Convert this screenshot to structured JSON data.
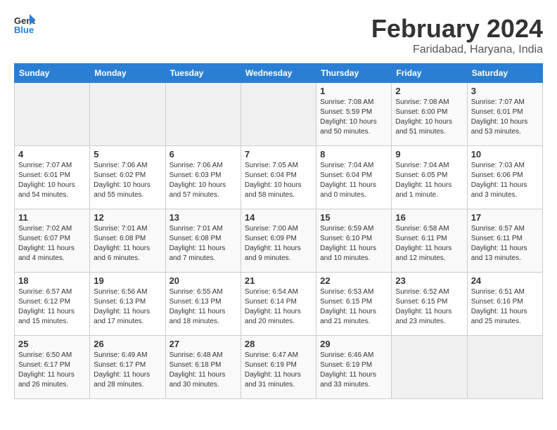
{
  "header": {
    "logo_line1": "General",
    "logo_line2": "Blue",
    "title": "February 2024",
    "subtitle": "Faridabad, Haryana, India"
  },
  "weekdays": [
    "Sunday",
    "Monday",
    "Tuesday",
    "Wednesday",
    "Thursday",
    "Friday",
    "Saturday"
  ],
  "weeks": [
    {
      "days": [
        {
          "num": "",
          "info": ""
        },
        {
          "num": "",
          "info": ""
        },
        {
          "num": "",
          "info": ""
        },
        {
          "num": "",
          "info": ""
        },
        {
          "num": "1",
          "info": "Sunrise: 7:08 AM\nSunset: 5:59 PM\nDaylight: 10 hours\nand 50 minutes."
        },
        {
          "num": "2",
          "info": "Sunrise: 7:08 AM\nSunset: 6:00 PM\nDaylight: 10 hours\nand 51 minutes."
        },
        {
          "num": "3",
          "info": "Sunrise: 7:07 AM\nSunset: 6:01 PM\nDaylight: 10 hours\nand 53 minutes."
        }
      ]
    },
    {
      "days": [
        {
          "num": "4",
          "info": "Sunrise: 7:07 AM\nSunset: 6:01 PM\nDaylight: 10 hours\nand 54 minutes."
        },
        {
          "num": "5",
          "info": "Sunrise: 7:06 AM\nSunset: 6:02 PM\nDaylight: 10 hours\nand 55 minutes."
        },
        {
          "num": "6",
          "info": "Sunrise: 7:06 AM\nSunset: 6:03 PM\nDaylight: 10 hours\nand 57 minutes."
        },
        {
          "num": "7",
          "info": "Sunrise: 7:05 AM\nSunset: 6:04 PM\nDaylight: 10 hours\nand 58 minutes."
        },
        {
          "num": "8",
          "info": "Sunrise: 7:04 AM\nSunset: 6:04 PM\nDaylight: 11 hours\nand 0 minutes."
        },
        {
          "num": "9",
          "info": "Sunrise: 7:04 AM\nSunset: 6:05 PM\nDaylight: 11 hours\nand 1 minute."
        },
        {
          "num": "10",
          "info": "Sunrise: 7:03 AM\nSunset: 6:06 PM\nDaylight: 11 hours\nand 3 minutes."
        }
      ]
    },
    {
      "days": [
        {
          "num": "11",
          "info": "Sunrise: 7:02 AM\nSunset: 6:07 PM\nDaylight: 11 hours\nand 4 minutes."
        },
        {
          "num": "12",
          "info": "Sunrise: 7:01 AM\nSunset: 6:08 PM\nDaylight: 11 hours\nand 6 minutes."
        },
        {
          "num": "13",
          "info": "Sunrise: 7:01 AM\nSunset: 6:08 PM\nDaylight: 11 hours\nand 7 minutes."
        },
        {
          "num": "14",
          "info": "Sunrise: 7:00 AM\nSunset: 6:09 PM\nDaylight: 11 hours\nand 9 minutes."
        },
        {
          "num": "15",
          "info": "Sunrise: 6:59 AM\nSunset: 6:10 PM\nDaylight: 11 hours\nand 10 minutes."
        },
        {
          "num": "16",
          "info": "Sunrise: 6:58 AM\nSunset: 6:11 PM\nDaylight: 11 hours\nand 12 minutes."
        },
        {
          "num": "17",
          "info": "Sunrise: 6:57 AM\nSunset: 6:11 PM\nDaylight: 11 hours\nand 13 minutes."
        }
      ]
    },
    {
      "days": [
        {
          "num": "18",
          "info": "Sunrise: 6:57 AM\nSunset: 6:12 PM\nDaylight: 11 hours\nand 15 minutes."
        },
        {
          "num": "19",
          "info": "Sunrise: 6:56 AM\nSunset: 6:13 PM\nDaylight: 11 hours\nand 17 minutes."
        },
        {
          "num": "20",
          "info": "Sunrise: 6:55 AM\nSunset: 6:13 PM\nDaylight: 11 hours\nand 18 minutes."
        },
        {
          "num": "21",
          "info": "Sunrise: 6:54 AM\nSunset: 6:14 PM\nDaylight: 11 hours\nand 20 minutes."
        },
        {
          "num": "22",
          "info": "Sunrise: 6:53 AM\nSunset: 6:15 PM\nDaylight: 11 hours\nand 21 minutes."
        },
        {
          "num": "23",
          "info": "Sunrise: 6:52 AM\nSunset: 6:15 PM\nDaylight: 11 hours\nand 23 minutes."
        },
        {
          "num": "24",
          "info": "Sunrise: 6:51 AM\nSunset: 6:16 PM\nDaylight: 11 hours\nand 25 minutes."
        }
      ]
    },
    {
      "days": [
        {
          "num": "25",
          "info": "Sunrise: 6:50 AM\nSunset: 6:17 PM\nDaylight: 11 hours\nand 26 minutes."
        },
        {
          "num": "26",
          "info": "Sunrise: 6:49 AM\nSunset: 6:17 PM\nDaylight: 11 hours\nand 28 minutes."
        },
        {
          "num": "27",
          "info": "Sunrise: 6:48 AM\nSunset: 6:18 PM\nDaylight: 11 hours\nand 30 minutes."
        },
        {
          "num": "28",
          "info": "Sunrise: 6:47 AM\nSunset: 6:19 PM\nDaylight: 11 hours\nand 31 minutes."
        },
        {
          "num": "29",
          "info": "Sunrise: 6:46 AM\nSunset: 6:19 PM\nDaylight: 11 hours\nand 33 minutes."
        },
        {
          "num": "",
          "info": ""
        },
        {
          "num": "",
          "info": ""
        }
      ]
    }
  ]
}
